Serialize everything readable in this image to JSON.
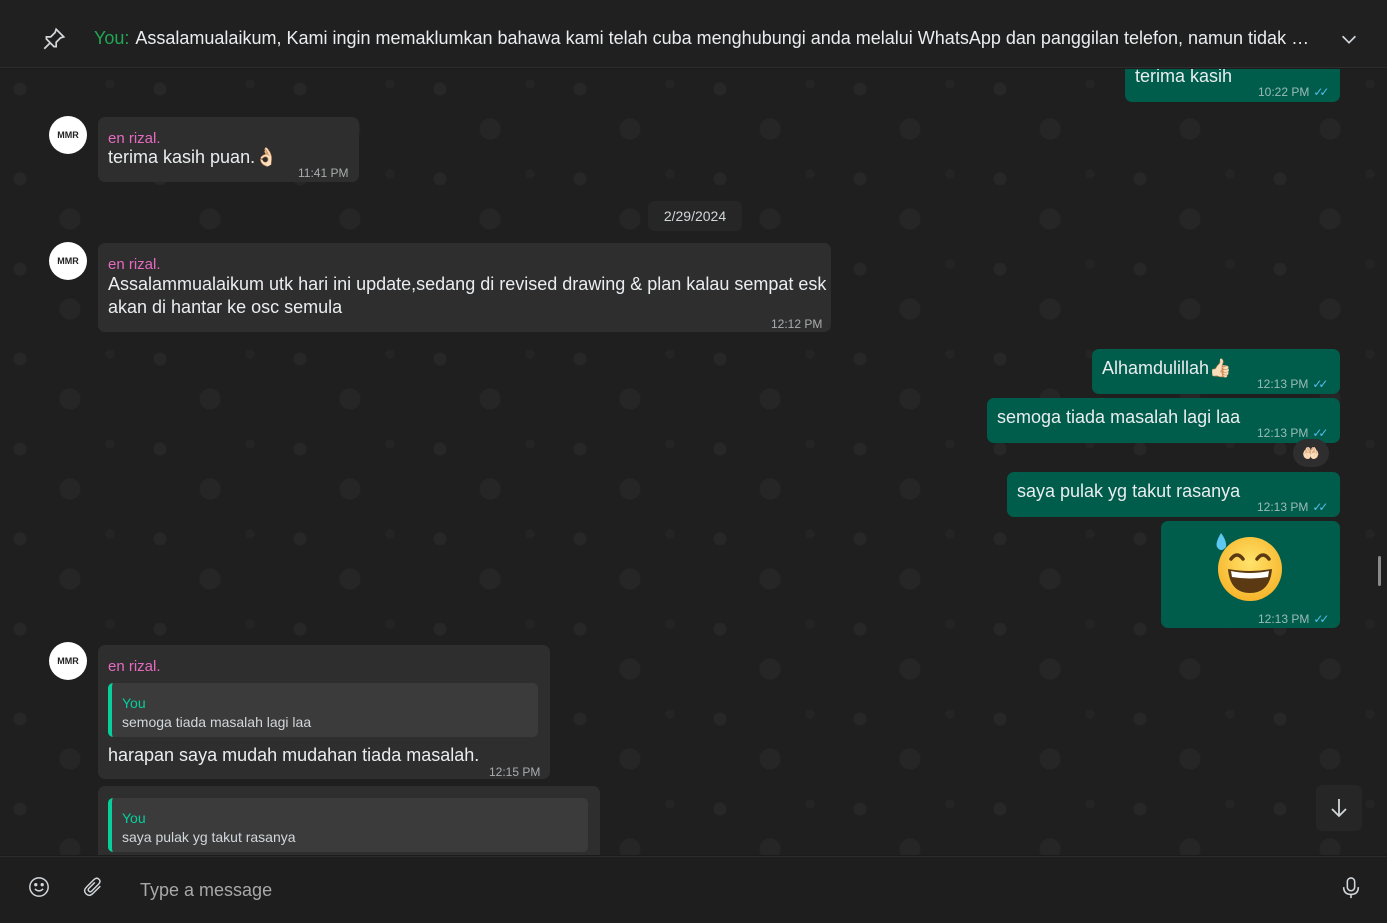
{
  "pinned": {
    "you_label": "You:",
    "text": "Assalamualaikum,  Kami ingin memaklumkan bahawa kami telah cuba menghubungi anda melalui WhatsApp dan panggilan telefon, namun tidak mener..."
  },
  "messages": {
    "m0": {
      "text": "terima kasih",
      "time": "10:22 PM"
    },
    "m1": {
      "sender": "en rizal.",
      "text": "terima kasih puan.👌🏻",
      "time": "11:41 PM"
    },
    "date": "2/29/2024",
    "m2": {
      "sender": "en rizal.",
      "line1": "Assalammualaikum utk hari ini update,sedang di  revised drawing & plan kalau sempat esk",
      "line2": "akan di hantar ke osc semula",
      "time": "12:12 PM"
    },
    "m3": {
      "text": "Alhamdulillah👍🏻",
      "time": "12:13 PM"
    },
    "m4": {
      "text": "semoga tiada masalah lagi laa",
      "time": "12:13 PM",
      "reaction": "🤲🏻"
    },
    "m5": {
      "text": "saya pulak yg takut rasanya",
      "time": "12:13 PM"
    },
    "m6": {
      "time": "12:13 PM"
    },
    "m7": {
      "sender": "en rizal.",
      "quote_author": "You",
      "quote_text": "semoga tiada masalah lagi laa",
      "text": "harapan saya mudah mudahan tiada masalah.",
      "time": "12:15 PM"
    },
    "m8": {
      "quote_author": "You",
      "quote_text": "saya pulak yg takut rasanya"
    }
  },
  "avatar_text": "MMR",
  "composer": {
    "placeholder": "Type a message"
  },
  "colors": {
    "outgoing": "#005c4b",
    "incoming": "#2e2e2e",
    "sender": "#e56ac0",
    "accent": "#06cf9c",
    "read_ticks": "#53bdeb"
  },
  "icons": [
    "pin-icon",
    "chevron-down-icon",
    "emoji-icon",
    "paperclip-icon",
    "microphone-icon",
    "arrow-down-icon",
    "double-check-icon"
  ]
}
